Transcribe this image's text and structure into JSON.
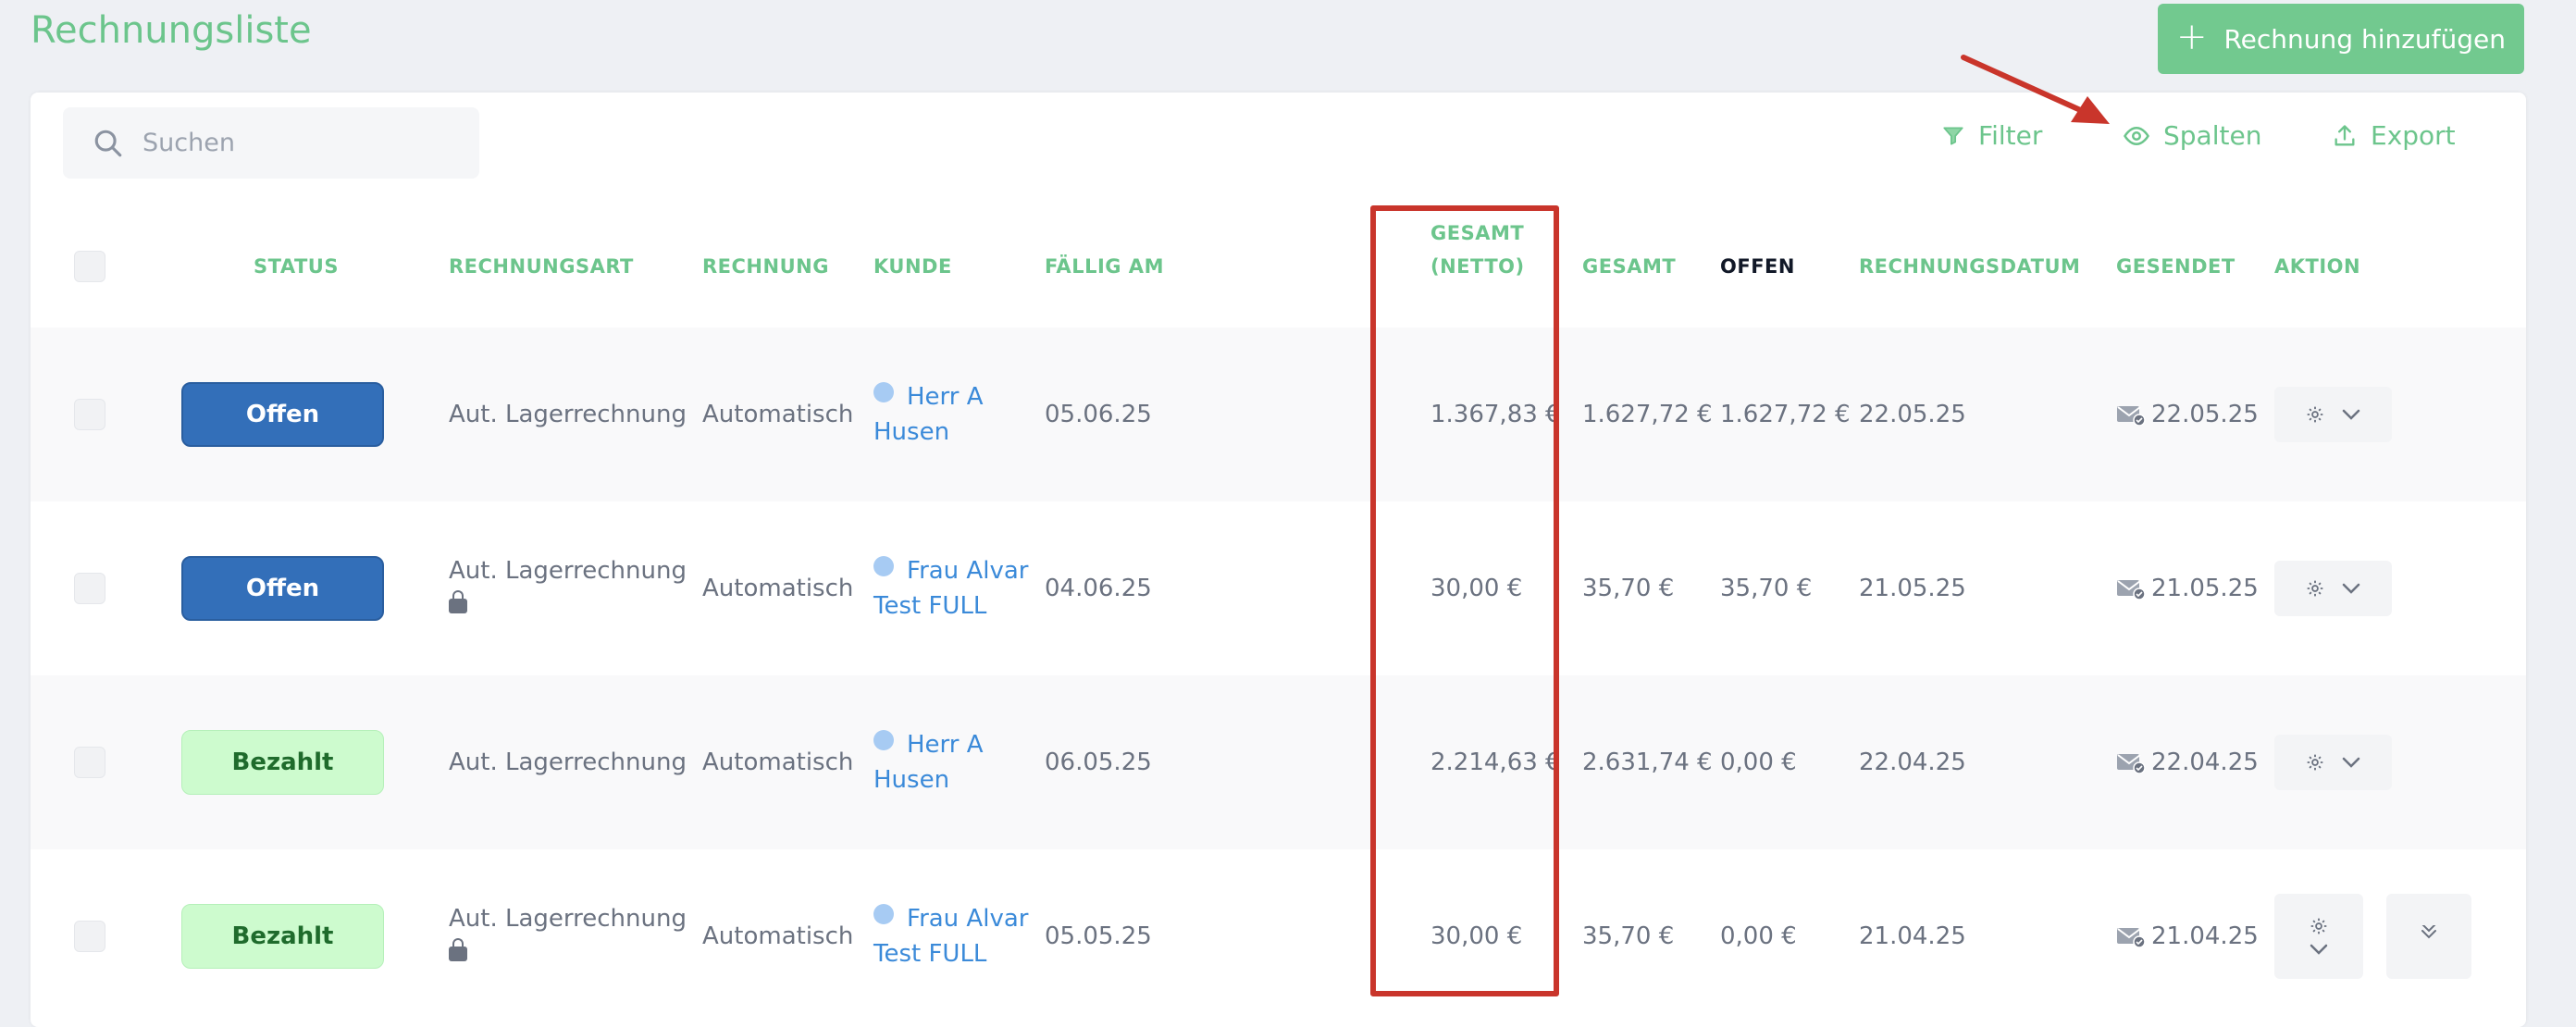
{
  "page": {
    "title": "Rechnungsliste"
  },
  "header": {
    "add_button_label": "Rechnung hinzufügen"
  },
  "toolbar": {
    "search_placeholder": "Suchen",
    "filter_label": "Filter",
    "columns_label": "Spalten",
    "export_label": "Export"
  },
  "table": {
    "headers": {
      "status": "STATUS",
      "rechnungsart": "RECHNUNGSART",
      "rechnung": "RECHNUNG",
      "kunde": "KUNDE",
      "faellig": "FÄLLIG AM",
      "gesamt_netto_1": "GESAMT",
      "gesamt_netto_2": "(NETTO)",
      "gesamt": "GESAMT",
      "offen": "OFFEN",
      "rechnungsdatum": "RECHNUNGSDATUM",
      "gesendet": "GESENDET",
      "aktion": "AKTION"
    },
    "rows": [
      {
        "status": "Offen",
        "rechnungsart": "Aut. Lagerrechnung",
        "rechnung": "Automatisch",
        "kunde_1": "Herr A",
        "kunde_2": "Husen",
        "faellig": "05.06.25",
        "gesamt_netto": "1.367,83 €",
        "gesamt": "1.627,72 €",
        "offen": "1.627,72 €",
        "rechnungsdatum": "22.05.25",
        "gesendet": "22.05.25"
      },
      {
        "status": "Offen",
        "rechnungsart": "Aut. Lagerrechnung",
        "rechnung": "Automatisch",
        "kunde_1": "Frau Alvar",
        "kunde_2": "Test FULL",
        "faellig": "04.06.25",
        "gesamt_netto": "30,00 €",
        "gesamt": "35,70 €",
        "offen": "35,70 €",
        "rechnungsdatum": "21.05.25",
        "gesendet": "21.05.25"
      },
      {
        "status": "Bezahlt",
        "rechnungsart": "Aut. Lagerrechnung",
        "rechnung": "Automatisch",
        "kunde_1": "Herr A",
        "kunde_2": "Husen",
        "faellig": "06.05.25",
        "gesamt_netto": "2.214,63 €",
        "gesamt": "2.631,74 €",
        "offen": "0,00 €",
        "rechnungsdatum": "22.04.25",
        "gesendet": "22.04.25"
      },
      {
        "status": "Bezahlt",
        "rechnungsart": "Aut. Lagerrechnung",
        "rechnung": "Automatisch",
        "kunde_1": "Frau Alvar",
        "kunde_2": "Test FULL",
        "faellig": "05.05.25",
        "gesamt_netto": "30,00 €",
        "gesamt": "35,70 €",
        "offen": "0,00 €",
        "rechnungsdatum": "21.04.25",
        "gesendet": "21.04.25"
      }
    ]
  },
  "colors": {
    "accent": "#6cc58c",
    "status_open": "#336fb9",
    "status_paid": "#cdfbce",
    "link": "#3b8ad9",
    "annotation": "#c9352b"
  }
}
